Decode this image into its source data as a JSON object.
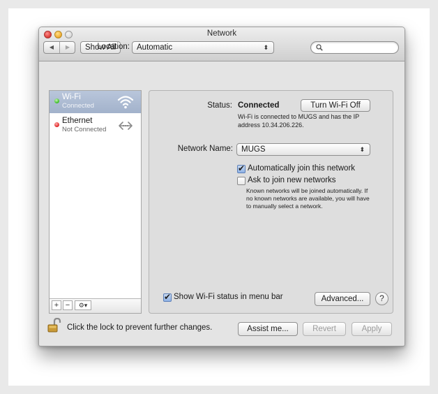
{
  "window": {
    "title": "Network"
  },
  "toolbar": {
    "back_icon": "back-arrow-icon",
    "forward_icon": "forward-arrow-icon",
    "show_all_label": "Show All"
  },
  "search": {
    "placeholder": "",
    "value": ""
  },
  "location": {
    "label": "Location:",
    "value": "Automatic"
  },
  "services": [
    {
      "name": "Wi-Fi",
      "status": "Connected",
      "status_color": "#3fbf2a",
      "icon": "wifi-icon",
      "selected": true
    },
    {
      "name": "Ethernet",
      "status": "Not Connected",
      "status_color": "#e02a2a",
      "icon": "ethernet-icon",
      "selected": false
    }
  ],
  "sidebar_buttons": {
    "add": "+",
    "remove": "−",
    "action": "⚙▾"
  },
  "status": {
    "label": "Status:",
    "value": "Connected",
    "turn_off_label": "Turn Wi-Fi Off",
    "description": "Wi-Fi is connected to MUGS and has the IP address 10.34.206.226."
  },
  "network_name": {
    "label": "Network Name:",
    "value": "MUGS"
  },
  "options": {
    "auto_join": {
      "label": "Automatically join this network",
      "checked": true
    },
    "ask_join": {
      "label": "Ask to join new networks",
      "checked": false
    },
    "hint": "Known networks will be joined automatically. If no known networks are available, you will have to manually select a network."
  },
  "menu_bar_status": {
    "label": "Show Wi-Fi status in menu bar",
    "checked": true
  },
  "advanced_label": "Advanced...",
  "help_label": "?",
  "footer": {
    "lock_text": "Click the lock to prevent further changes.",
    "assist_label": "Assist me...",
    "revert_label": "Revert",
    "apply_label": "Apply"
  },
  "colors": {
    "selection": "#a2b2cb",
    "checkbox_checked": "#8fb2e6"
  }
}
